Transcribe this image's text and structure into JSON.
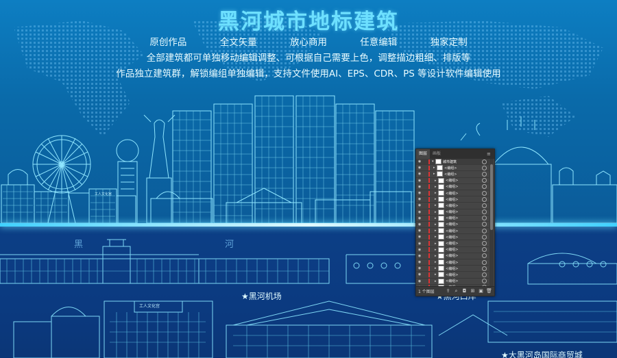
{
  "header": {
    "title": "黑河城市地标建筑",
    "features": [
      "原创作品",
      "全文矢量",
      "放心商用",
      "任意编辑",
      "独家定制"
    ],
    "line1": "全部建筑都可单独移动编辑调整、可根据自己需要上色，调整描边粗细、排版等",
    "line2": "作品独立建筑群，解锁编组单独编辑，支持文件使用AI、EPS、CDR、PS 等设计软件编辑使用"
  },
  "labels": {
    "left_sign_1": "黑",
    "left_sign_2": "河",
    "airport": "★黑河机场",
    "port": "★黑河口岸",
    "trade_city": "★大黑河岛国际商贸城",
    "culture_palace": "工人文化宫",
    "small_sign": "工人文化宫"
  },
  "colors": {
    "sky_top": "#0d7ec2",
    "ground": "#0b3a80",
    "line": "#8fe6ff",
    "title": "#6de0ff"
  },
  "layers_panel": {
    "tabs": [
      "图层",
      "画板"
    ],
    "menu_icon": "hamburger-icon",
    "root_name": "城市建筑",
    "rows": [
      "<编组>",
      "<编组>",
      "<编组>",
      "<编组>",
      "<编组>",
      "<编组>",
      "<编组>",
      "<编组>",
      "<编组>",
      "<编组>",
      "<编组>",
      "<编组>",
      "<编组>",
      "<编组>",
      "<编组>",
      "<编组>",
      "<编组>",
      "<编组>",
      "<编组>",
      "<编组>",
      "<编组>"
    ],
    "footer_count": "1 个图层",
    "footer_icons": [
      "export-icon",
      "locate-icon",
      "clip-mask-icon",
      "new-sublayer-icon",
      "new-layer-icon",
      "delete-icon"
    ]
  }
}
